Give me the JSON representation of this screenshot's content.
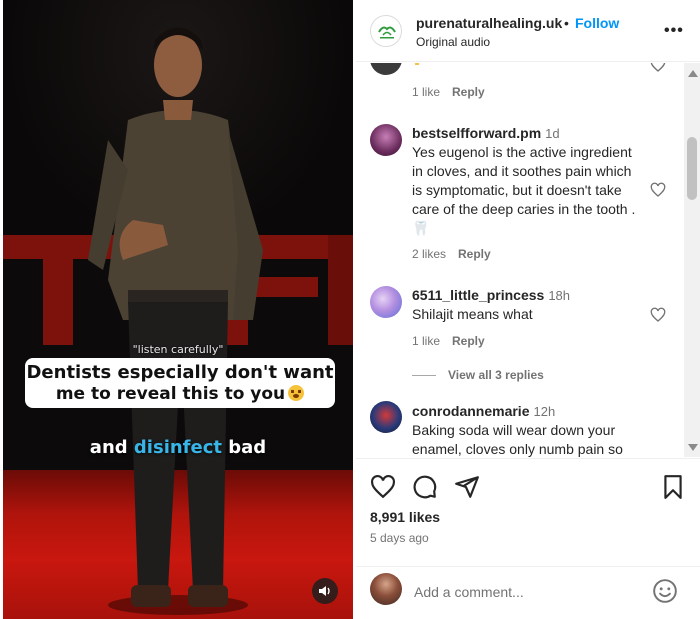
{
  "video": {
    "caption_small": "\"listen carefully\"",
    "caption_line1": "Dentists especially don't want",
    "caption_line2": "me to reveal this to you",
    "caption_bottom_pre": "and ",
    "caption_bottom_highlight": "disinfect",
    "caption_bottom_post": " bad",
    "highlight_color": "#38b6e8",
    "mute_icon": "speaker-icon"
  },
  "header": {
    "username": "purenaturalhealing.uk",
    "separator": "•",
    "follow_label": "Follow",
    "audio_label": "Original audio",
    "more_label": "•••"
  },
  "comments": [
    {
      "likes": "1 like",
      "reply": "Reply"
    },
    {
      "user": "bestselfforward.pm",
      "time": "1d",
      "text": "Yes eugenol is the active ingredient in cloves, and it soothes pain which is symptomatic, but it doesn't take care of the deep caries in the tooth . 🦷",
      "likes": "2 likes",
      "reply": "Reply"
    },
    {
      "user": "6511_little_princess",
      "time": "18h",
      "text": "Shilajit means what",
      "likes": "1 like",
      "reply": "Reply",
      "view_replies": "View all 3 replies"
    },
    {
      "user": "conrodannemarie",
      "time": "12h",
      "text": "Baking soda will wear down your enamel, cloves only numb pain so"
    }
  ],
  "actions": {
    "likes_count": "8,991 likes",
    "posted_ago": "5 days ago"
  },
  "add_comment": {
    "placeholder": "Add a comment..."
  },
  "colors": {
    "link_blue": "#0095f6",
    "muted_text": "#737373",
    "stage_red": "#c8170e"
  }
}
